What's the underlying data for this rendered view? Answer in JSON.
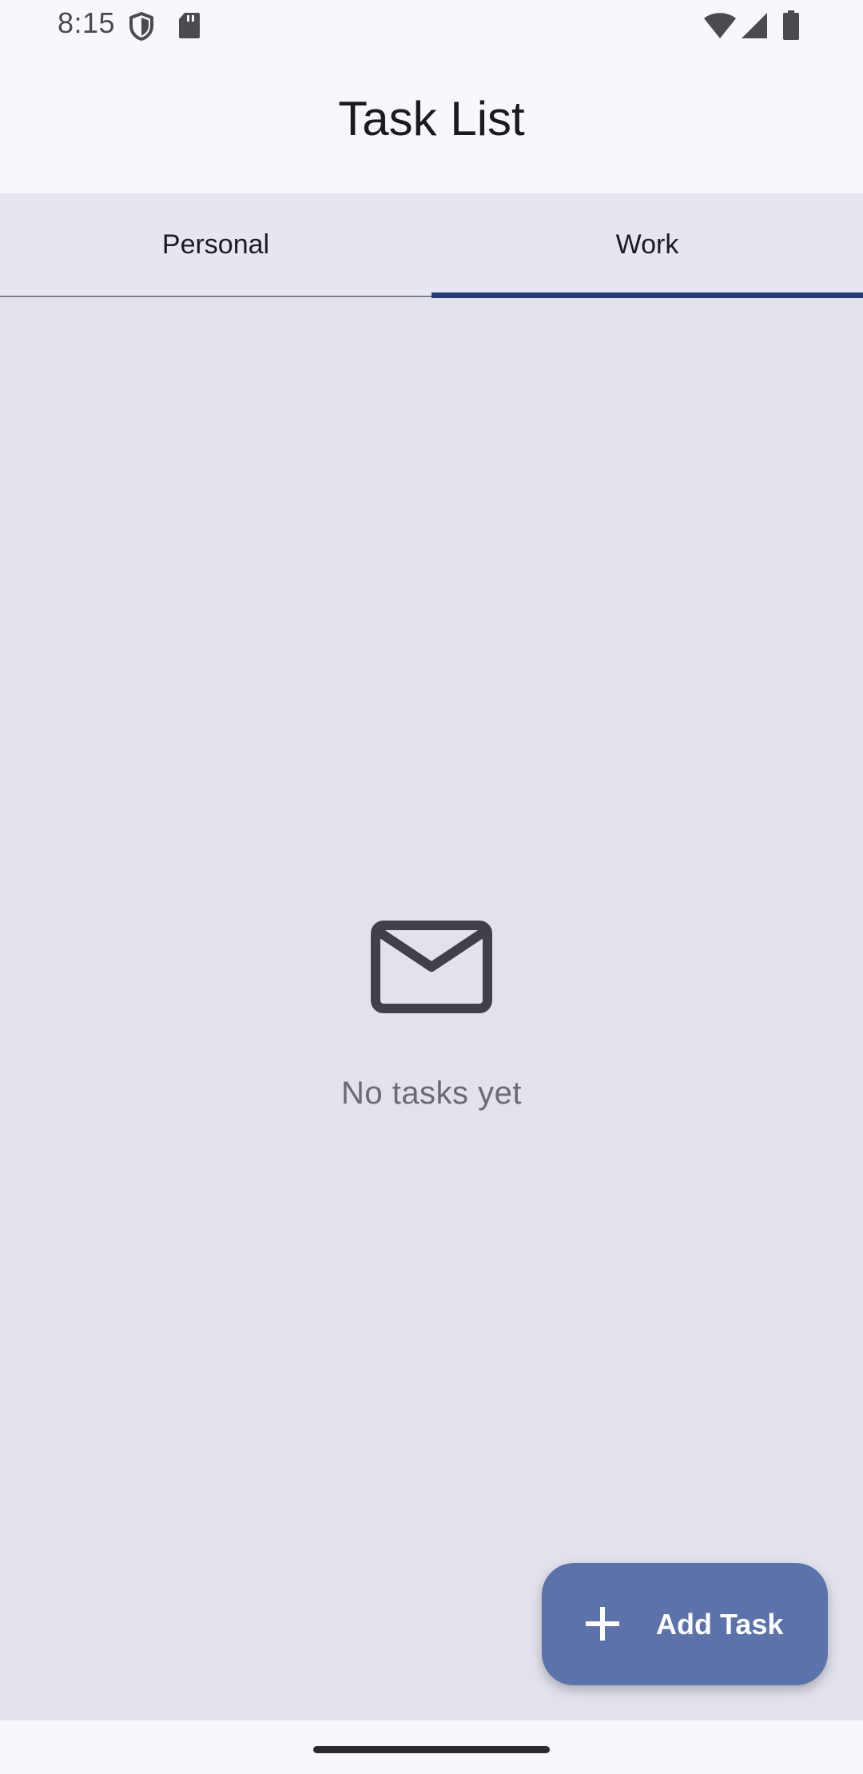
{
  "status_bar": {
    "time": "8:15",
    "icons": [
      "shield-icon",
      "sd-card-icon",
      "wifi-icon",
      "cellular-signal-icon",
      "battery-icon"
    ]
  },
  "app_bar": {
    "title": "Task List"
  },
  "tabs": [
    {
      "label": "Personal",
      "selected": false
    },
    {
      "label": "Work",
      "selected": true
    }
  ],
  "empty_state": {
    "icon": "mail-icon",
    "message": "No tasks yet"
  },
  "fab": {
    "icon": "plus-icon",
    "label": "Add Task"
  },
  "colors": {
    "accent": "#263b73",
    "fab": "#5c72aa",
    "background": "#e2e2ec"
  }
}
